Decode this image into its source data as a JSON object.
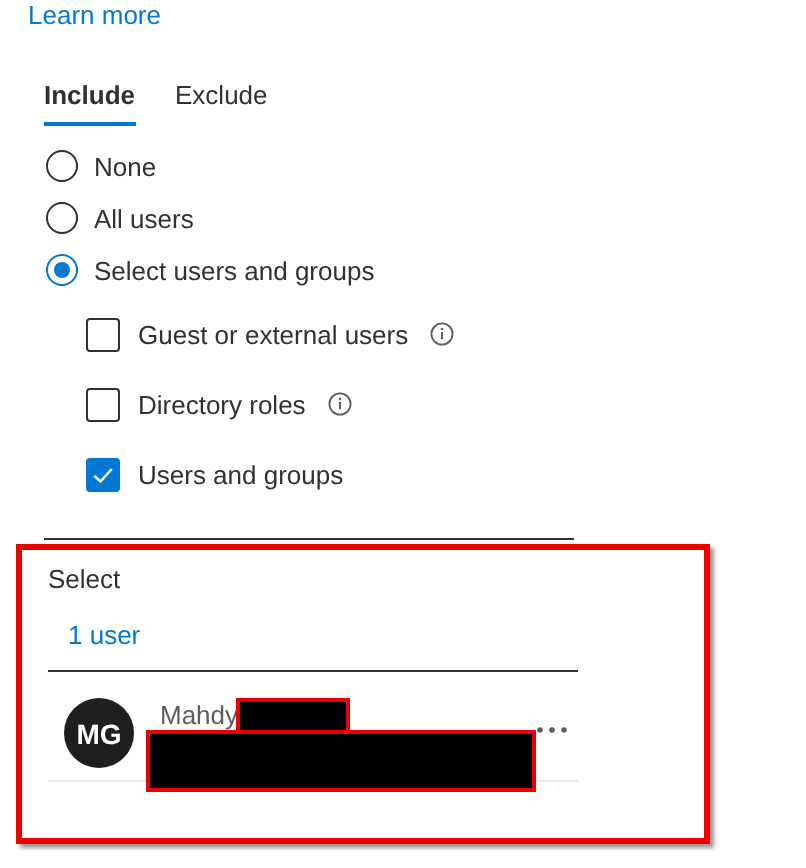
{
  "learn_more_link": "Learn more",
  "tabs": [
    {
      "label": "Include",
      "selected": true
    },
    {
      "label": "Exclude",
      "selected": false
    }
  ],
  "options": [
    {
      "label": "None",
      "selected": false
    },
    {
      "label": "All users",
      "selected": false
    },
    {
      "label": "Select users and groups",
      "selected": true
    }
  ],
  "sub_options": [
    {
      "label": "Guest or external users",
      "checked": false,
      "info": true
    },
    {
      "label": "Directory roles",
      "checked": false,
      "info": true
    },
    {
      "label": "Users and groups",
      "checked": true,
      "info": false
    }
  ],
  "select_panel": {
    "highlighted": true,
    "label": "Select",
    "link": "1 user",
    "users": [
      {
        "initials": "MG",
        "name": "Mahdy",
        "name_redacted": true,
        "detail_redacted": true
      }
    ]
  }
}
